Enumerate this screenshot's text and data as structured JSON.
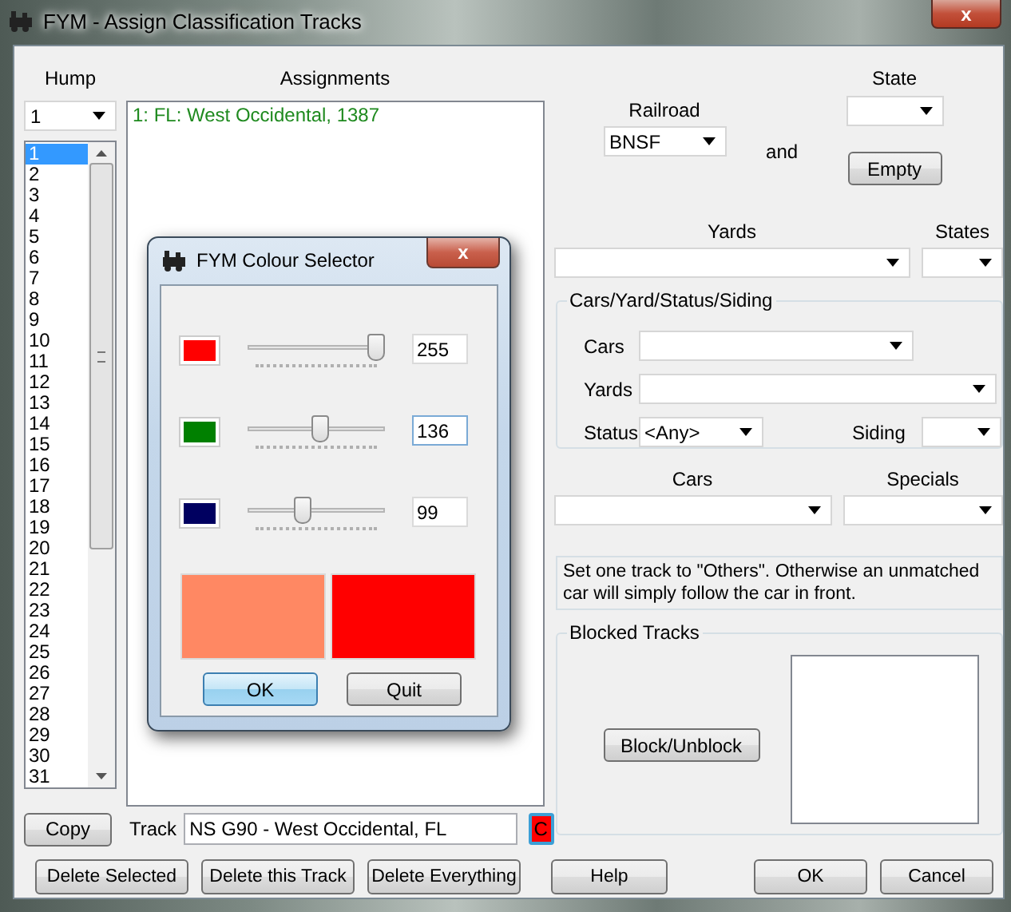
{
  "window": {
    "title": "FYM - Assign Classification Tracks",
    "close": "x"
  },
  "hump": {
    "label": "Hump",
    "value": "1",
    "items": [
      {
        "label": "1",
        "selected": true
      },
      {
        "label": "2",
        "selected": false
      },
      {
        "label": "3",
        "selected": false
      },
      {
        "label": "4",
        "selected": false
      },
      {
        "label": "5",
        "selected": false
      },
      {
        "label": "6",
        "selected": false
      },
      {
        "label": "7",
        "selected": false
      },
      {
        "label": "8",
        "selected": false
      },
      {
        "label": "9",
        "selected": false
      },
      {
        "label": "10",
        "selected": false
      },
      {
        "label": "11",
        "selected": false
      },
      {
        "label": "12",
        "selected": false
      },
      {
        "label": "13",
        "selected": false
      },
      {
        "label": "14",
        "selected": false
      },
      {
        "label": "15",
        "selected": false
      },
      {
        "label": "16",
        "selected": false
      },
      {
        "label": "17",
        "selected": false
      },
      {
        "label": "18",
        "selected": false
      },
      {
        "label": "19",
        "selected": false
      },
      {
        "label": "20",
        "selected": false
      },
      {
        "label": "21",
        "selected": false
      },
      {
        "label": "22",
        "selected": false
      },
      {
        "label": "23",
        "selected": false
      },
      {
        "label": "24",
        "selected": false
      },
      {
        "label": "25",
        "selected": false
      },
      {
        "label": "26",
        "selected": false
      },
      {
        "label": "27",
        "selected": false
      },
      {
        "label": "28",
        "selected": false
      },
      {
        "label": "29",
        "selected": false
      },
      {
        "label": "30",
        "selected": false
      },
      {
        "label": "31",
        "selected": false
      }
    ]
  },
  "assignments": {
    "label": "Assignments",
    "items": [
      "1: FL: West Occidental, 1387"
    ]
  },
  "railroad": {
    "label": "Railroad",
    "value": "BNSF"
  },
  "and_label": "and",
  "state": {
    "label": "State"
  },
  "empty_button": "Empty",
  "yards": {
    "label": "Yards"
  },
  "states": {
    "label": "States"
  },
  "group": {
    "title": "Cars/Yard/Status/Siding",
    "cars_label": "Cars",
    "yards_label": "Yards",
    "status_label": "Status",
    "status_value": "<Any>",
    "siding_label": "Siding"
  },
  "cars": {
    "label": "Cars"
  },
  "specials": {
    "label": "Specials"
  },
  "note": "Set one track to \"Others\". Otherwise an unmatched car will simply follow the car in front.",
  "blocked": {
    "title": "Blocked Tracks",
    "button": "Block/Unblock"
  },
  "copy_button": "Copy",
  "track": {
    "label": "Track",
    "value": "NS G90 - West Occidental, FL",
    "color_button": "C",
    "color": "#ff0000"
  },
  "buttons": [
    {
      "label": "Delete Selected",
      "kind": "left"
    },
    {
      "label": "Delete this Track",
      "kind": "left"
    },
    {
      "label": "Delete Everything",
      "kind": "left"
    },
    {
      "label": "Help",
      "kind": "help"
    },
    {
      "label": "OK",
      "kind": "right"
    },
    {
      "label": "Cancel",
      "kind": "right"
    }
  ],
  "dialog": {
    "title": "FYM Colour Selector",
    "close": "x",
    "channels": [
      {
        "color": "#ff0000",
        "level": 1,
        "value": "255",
        "focused": false
      },
      {
        "color": "#008000",
        "level": 0.53,
        "value": "136",
        "focused": true
      },
      {
        "color": "#000060",
        "level": 0.39,
        "value": "99",
        "focused": false
      }
    ],
    "preview": [
      {
        "color": "#ff8863"
      },
      {
        "color": "#ff0000"
      }
    ],
    "buttons": [
      {
        "label": "OK",
        "default": true
      },
      {
        "label": "Quit",
        "default": false
      }
    ]
  }
}
